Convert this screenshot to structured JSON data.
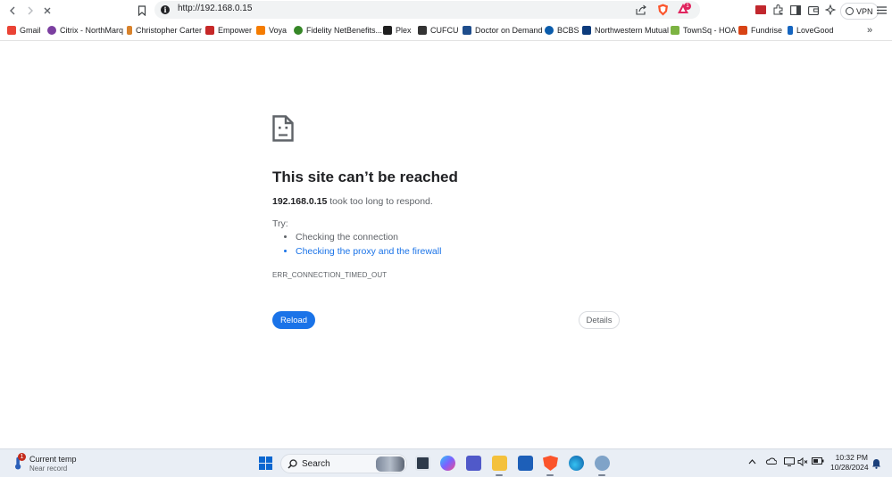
{
  "browser": {
    "url": "http://192.168.0.15",
    "vpn_label": "VPN",
    "brave_notification_count": "1",
    "icons": {
      "back": "back-arrow-icon",
      "forward": "forward-arrow-icon",
      "stop": "stop-loading-icon",
      "bookmark": "bookmark-icon",
      "site_info": "info-icon",
      "share": "share-icon",
      "shields": "brave-shields-icon",
      "rewards": "brave-rewards-icon",
      "extension": "extension-icon",
      "puzzle": "extensions-puzzle-icon",
      "sidebar": "sidebar-icon",
      "wallet": "wallet-icon",
      "leo": "leo-ai-icon",
      "menu": "hamburger-menu-icon"
    }
  },
  "bookmarks": [
    {
      "label": "Gmail",
      "color": "#ea4335"
    },
    {
      "label": "Citrix - NorthMarq",
      "color": "#7b3fa0"
    },
    {
      "label": "Christopher Carter",
      "color": "#d9822b"
    },
    {
      "label": "Empower",
      "color": "#c62828"
    },
    {
      "label": "Voya",
      "color": "#f57c00"
    },
    {
      "label": "Fidelity NetBenefits...",
      "color": "#368727"
    },
    {
      "label": "Plex",
      "color": "#1f1f1f"
    },
    {
      "label": "CUFCU",
      "color": "#333333"
    },
    {
      "label": "Doctor on Demand",
      "color": "#1e4d8c"
    },
    {
      "label": "BCBS",
      "color": "#0b5cab"
    },
    {
      "label": "Northwestern Mutual",
      "color": "#0c3b7c"
    },
    {
      "label": "TownSq - HOA",
      "color": "#7cb342"
    },
    {
      "label": "Fundrise",
      "color": "#d84315"
    },
    {
      "label": "LoveGood",
      "color": "#1565c0"
    }
  ],
  "error": {
    "title": "This site can’t be reached",
    "host": "192.168.0.15",
    "desc_suffix": " took too long to respond.",
    "try_label": "Try:",
    "suggestions": [
      "Checking the connection",
      "Checking the proxy and the firewall"
    ],
    "code": "ERR_CONNECTION_TIMED_OUT",
    "reload_label": "Reload",
    "details_label": "Details"
  },
  "taskbar": {
    "weather_title": "Current temp",
    "weather_subtitle": "Near record",
    "weather_badge": "1",
    "search_label": "Search",
    "time": "10:32 PM",
    "date": "10/28/2024"
  },
  "colors": {
    "accent": "#1a73e8",
    "text": "#202124",
    "muted": "#5f6368",
    "taskbar": "#e9eef5"
  }
}
